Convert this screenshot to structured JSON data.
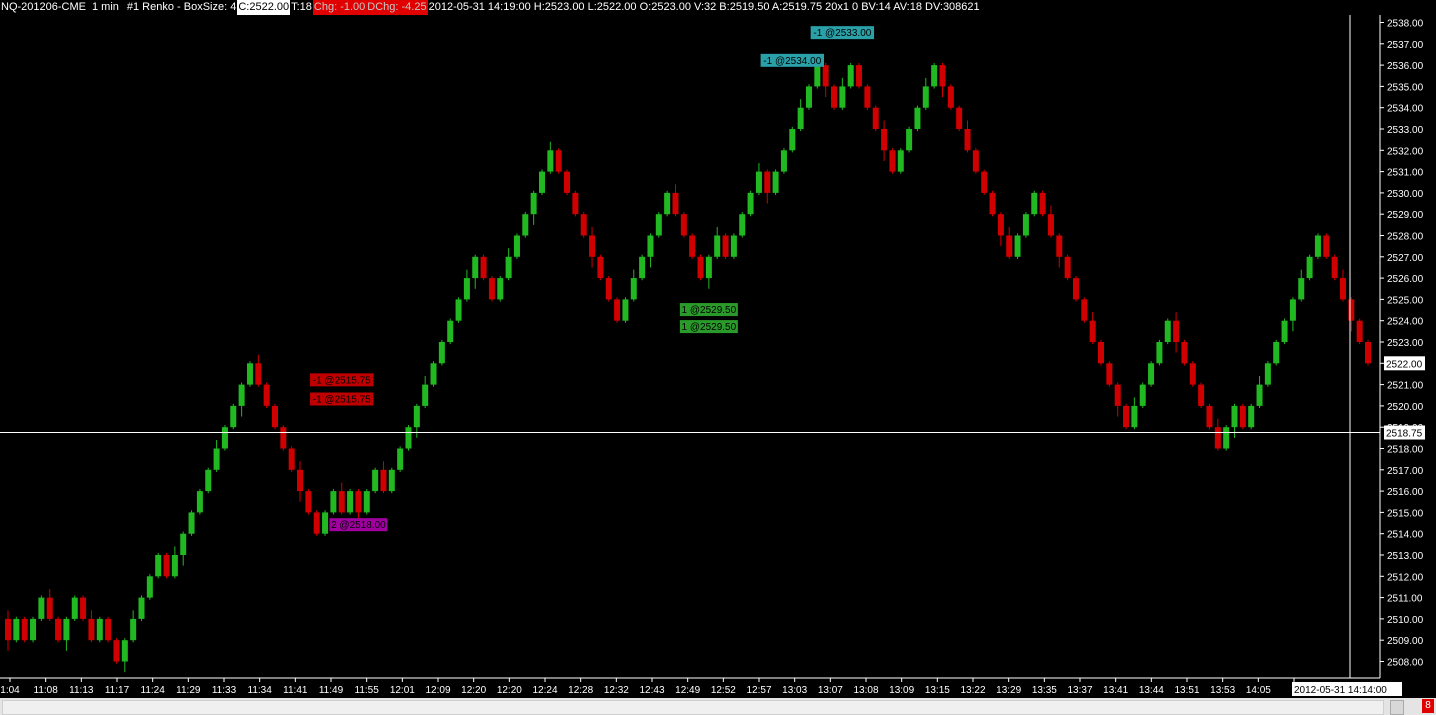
{
  "header": {
    "symbol": "NQ-201206-CME",
    "interval": "1 min",
    "study": "#1 Renko - BoxSize: 4",
    "close": "C:2522.00",
    "ticks": "T:18",
    "chg": "Chg: -1.00",
    "dchg": "DChg: -4.25",
    "stats": "2012-05-31 14:19:00 H:2523.00 L:2522.00 O:2523.00 V:32 B:2519.50 A:2519.75 20x1 0 BV:14 AV:18 DV:308621"
  },
  "colors": {
    "up": "#22b822",
    "down": "#d00000",
    "grid_label": "#ffffff",
    "crosshair": "#ffffff",
    "price_box": "#ffffff"
  },
  "current_price_label": "2522.00",
  "crosshair_price_label": "2518.75",
  "crosshair_time_label": "2012-05-31  14:14:00",
  "status_badge": "8",
  "trade_tags": [
    {
      "text": "-1 @2533.00",
      "color": "#2aa0a8",
      "bar": 100,
      "price": 2537.5
    },
    {
      "text": "-1 @2534.00",
      "color": "#2aa0a8",
      "bar": 94,
      "price": 2536.2
    },
    {
      "text": "1 @2529.50",
      "color": "#2a9a2a",
      "bar": 84,
      "price": 2524.5
    },
    {
      "text": "1 @2529.50",
      "color": "#2a9a2a",
      "bar": 84,
      "price": 2523.7
    },
    {
      "text": "-1 @2515.75",
      "color": "#c00000",
      "bar": 40,
      "price": 2521.2
    },
    {
      "text": "-1 @2515.75",
      "color": "#c00000",
      "bar": 40,
      "price": 2520.3
    },
    {
      "text": "2 @2518.00",
      "color": "#a000a0",
      "bar": 42,
      "price": 2514.4
    }
  ],
  "chart_data": {
    "type": "candlestick",
    "title": "",
    "ylim": [
      2507.5,
      2538.5
    ],
    "y_ticks": [
      2508,
      2509,
      2510,
      2511,
      2512,
      2513,
      2514,
      2515,
      2516,
      2517,
      2518,
      2519,
      2520,
      2521,
      2522,
      2523,
      2524,
      2525,
      2526,
      2527,
      2528,
      2529,
      2530,
      2531,
      2532,
      2533,
      2534,
      2535,
      2536,
      2537,
      2538
    ],
    "x_tick_labels": [
      "1:04",
      "11:08",
      "11:13",
      "11:17",
      "11:24",
      "11:29",
      "11:33",
      "11:34",
      "11:41",
      "11:49",
      "11:55",
      "12:01",
      "12:09",
      "12:20",
      "12:20",
      "12:24",
      "12:28",
      "12:32",
      "12:43",
      "12:49",
      "12:52",
      "12:57",
      "13:03",
      "13:07",
      "13:08",
      "13:09",
      "13:15",
      "13:22",
      "13:29",
      "13:35",
      "13:37",
      "13:41",
      "13:44",
      "13:51",
      "13:53",
      "14:05",
      "1"
    ],
    "renko_closes": [
      2509,
      2510,
      2509,
      2510,
      2511,
      2510,
      2509,
      2510,
      2511,
      2510,
      2509,
      2510,
      2509,
      2508,
      2509,
      2510,
      2511,
      2512,
      2513,
      2512,
      2513,
      2514,
      2515,
      2516,
      2517,
      2518,
      2519,
      2520,
      2521,
      2522,
      2521,
      2520,
      2519,
      2518,
      2517,
      2516,
      2515,
      2514,
      2515,
      2516,
      2515,
      2516,
      2515,
      2516,
      2517,
      2516,
      2517,
      2518,
      2519,
      2520,
      2521,
      2522,
      2523,
      2524,
      2525,
      2526,
      2527,
      2526,
      2525,
      2526,
      2527,
      2528,
      2529,
      2530,
      2531,
      2532,
      2531,
      2530,
      2529,
      2528,
      2527,
      2526,
      2525,
      2524,
      2525,
      2526,
      2527,
      2528,
      2529,
      2530,
      2529,
      2528,
      2527,
      2526,
      2527,
      2528,
      2527,
      2528,
      2529,
      2530,
      2531,
      2530,
      2531,
      2532,
      2533,
      2534,
      2535,
      2536,
      2535,
      2534,
      2535,
      2536,
      2535,
      2534,
      2533,
      2532,
      2531,
      2532,
      2533,
      2534,
      2535,
      2536,
      2535,
      2534,
      2533,
      2532,
      2531,
      2530,
      2529,
      2528,
      2527,
      2528,
      2529,
      2530,
      2529,
      2528,
      2527,
      2526,
      2525,
      2524,
      2523,
      2522,
      2521,
      2520,
      2519,
      2520,
      2521,
      2522,
      2523,
      2524,
      2523,
      2522,
      2521,
      2520,
      2519,
      2518,
      2519,
      2520,
      2519,
      2520,
      2521,
      2522,
      2523,
      2524,
      2525,
      2526,
      2527,
      2528,
      2527,
      2526,
      2525,
      2524,
      2523,
      2522
    ]
  }
}
